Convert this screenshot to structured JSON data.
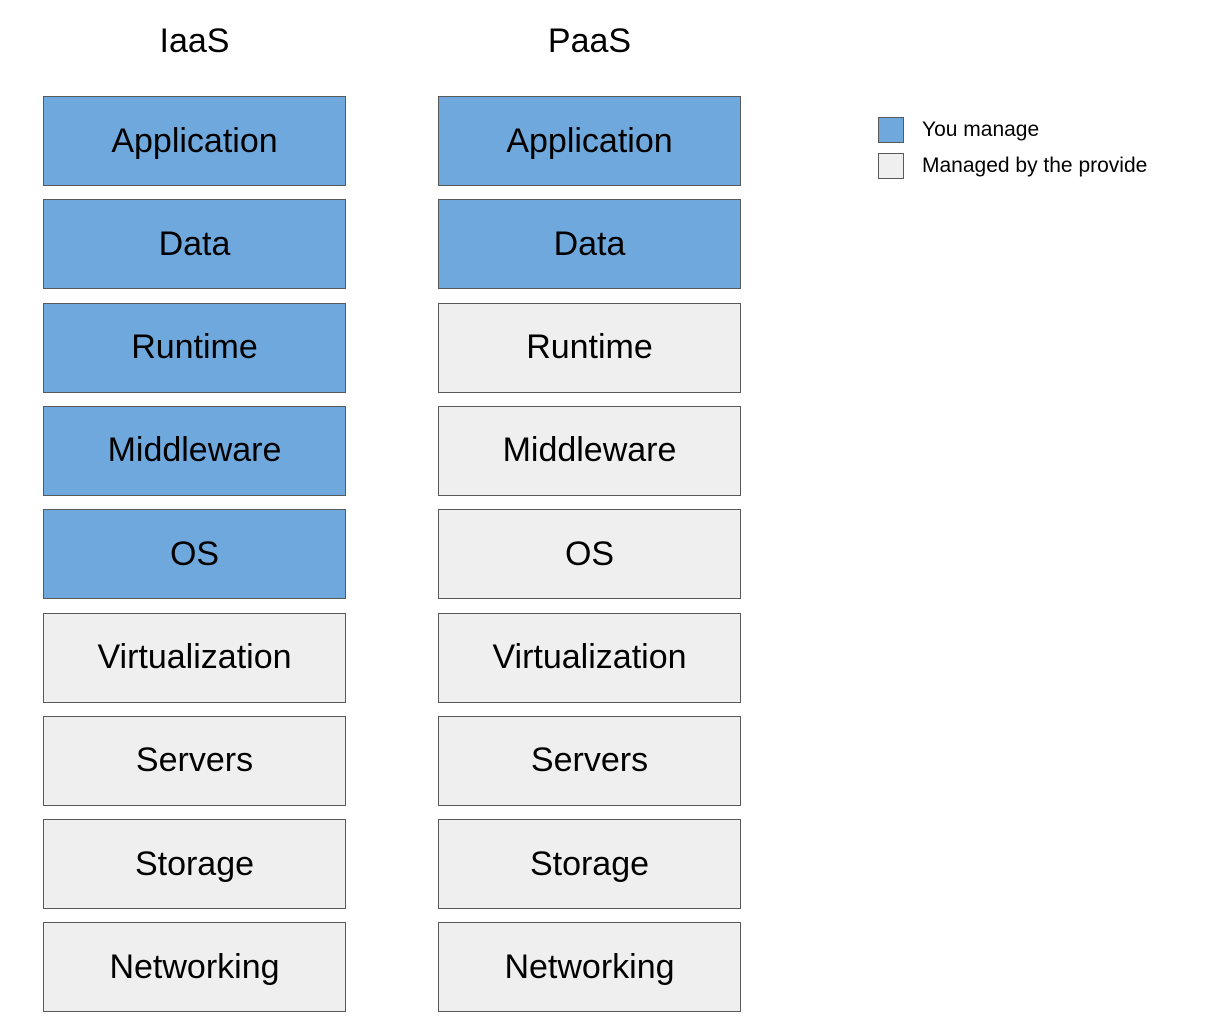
{
  "colors": {
    "you_manage": "#6fa8dc",
    "provider": "#efefef",
    "border": "#595959"
  },
  "columns": [
    {
      "title": "IaaS",
      "layers": [
        {
          "label": "Application",
          "managed_by": "you"
        },
        {
          "label": "Data",
          "managed_by": "you"
        },
        {
          "label": "Runtime",
          "managed_by": "you"
        },
        {
          "label": "Middleware",
          "managed_by": "you"
        },
        {
          "label": "OS",
          "managed_by": "you"
        },
        {
          "label": "Virtualization",
          "managed_by": "provider"
        },
        {
          "label": "Servers",
          "managed_by": "provider"
        },
        {
          "label": "Storage",
          "managed_by": "provider"
        },
        {
          "label": "Networking",
          "managed_by": "provider"
        }
      ]
    },
    {
      "title": "PaaS",
      "layers": [
        {
          "label": "Application",
          "managed_by": "you"
        },
        {
          "label": "Data",
          "managed_by": "you"
        },
        {
          "label": "Runtime",
          "managed_by": "provider"
        },
        {
          "label": "Middleware",
          "managed_by": "provider"
        },
        {
          "label": "OS",
          "managed_by": "provider"
        },
        {
          "label": "Virtualization",
          "managed_by": "provider"
        },
        {
          "label": "Servers",
          "managed_by": "provider"
        },
        {
          "label": "Storage",
          "managed_by": "provider"
        },
        {
          "label": "Networking",
          "managed_by": "provider"
        }
      ]
    }
  ],
  "legend": [
    {
      "label": "You manage",
      "key": "you"
    },
    {
      "label": "Managed by the provide",
      "key": "provider"
    }
  ]
}
